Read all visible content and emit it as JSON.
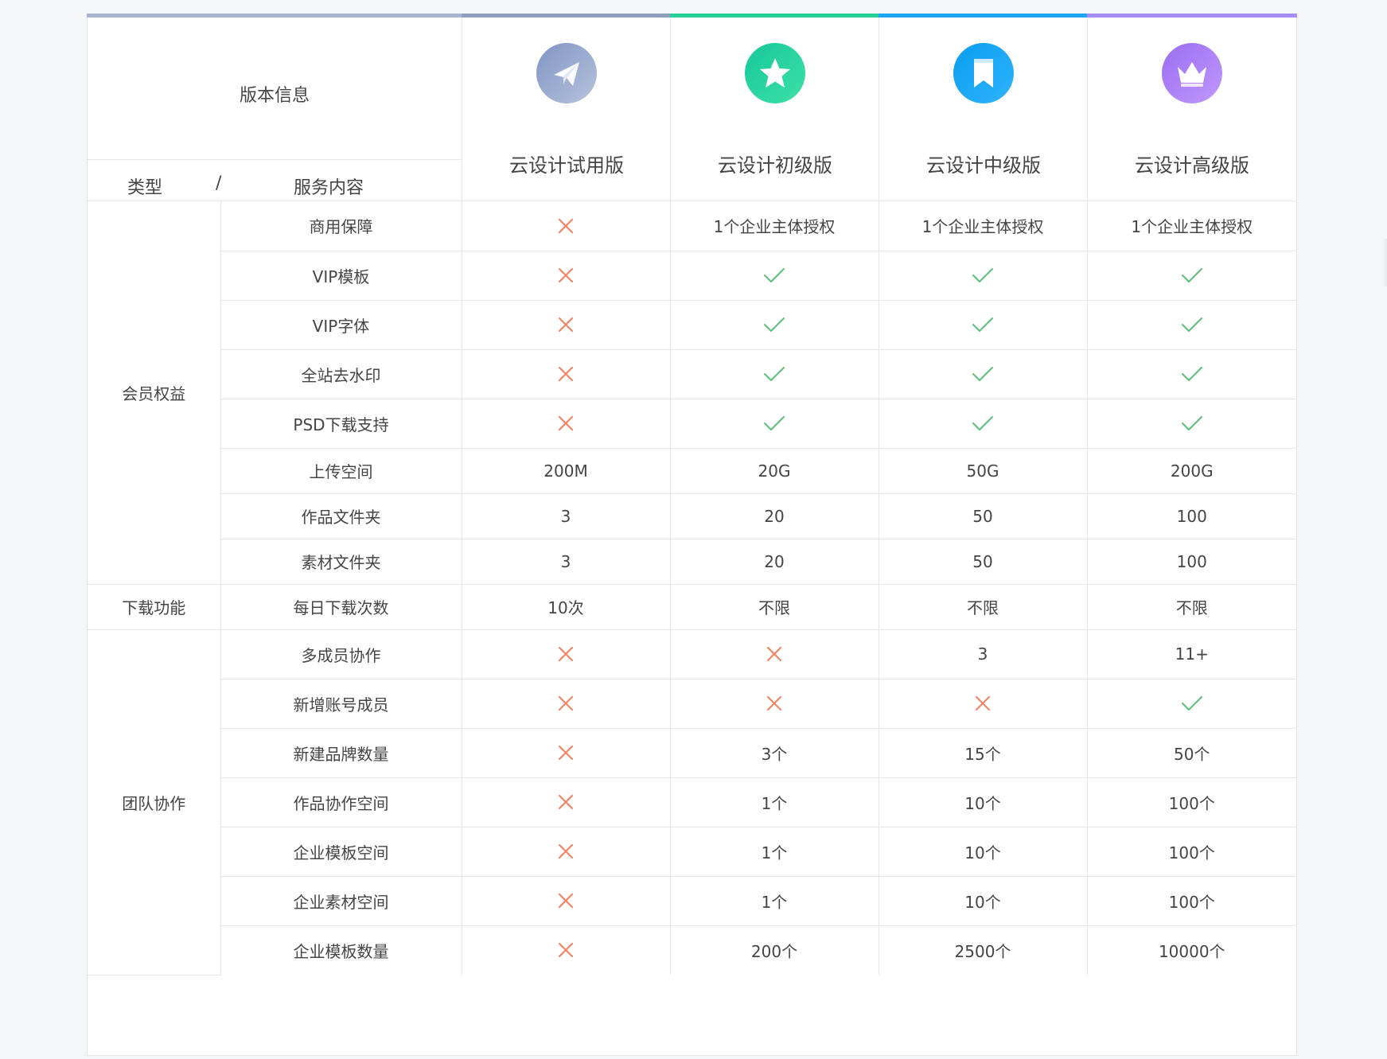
{
  "header": {
    "title": "版本信息",
    "type_label": "类型",
    "slash": "/",
    "service_label": "服务内容"
  },
  "plans": [
    {
      "name": "云设计试用版",
      "icon": "paper-plane-icon",
      "color": "#8f9fbe"
    },
    {
      "name": "云设计初级版",
      "icon": "star-icon",
      "color": "#25cf96"
    },
    {
      "name": "云设计中级版",
      "icon": "bookmark-icon",
      "color": "#1ca6f5"
    },
    {
      "name": "云设计高级版",
      "icon": "crown-icon",
      "color": "#a48df7"
    }
  ],
  "status_colors": {
    "cross": "#f4805e",
    "check": "#5cbf7c"
  },
  "categories": [
    {
      "name": "会员权益",
      "rows": [
        {
          "service": "商用保障",
          "values": [
            "cross",
            "1个企业主体授权",
            "1个企业主体授权",
            "1个企业主体授权"
          ]
        },
        {
          "service": "VIP模板",
          "values": [
            "cross",
            "check",
            "check",
            "check"
          ]
        },
        {
          "service": "VIP字体",
          "values": [
            "cross",
            "check",
            "check",
            "check"
          ]
        },
        {
          "service": "全站去水印",
          "values": [
            "cross",
            "check",
            "check",
            "check"
          ]
        },
        {
          "service": "PSD下载支持",
          "values": [
            "cross",
            "check",
            "check",
            "check"
          ]
        },
        {
          "service": "上传空间",
          "values": [
            "200M",
            "20G",
            "50G",
            "200G"
          ]
        },
        {
          "service": "作品文件夹",
          "values": [
            "3",
            "20",
            "50",
            "100"
          ]
        },
        {
          "service": "素材文件夹",
          "values": [
            "3",
            "20",
            "50",
            "100"
          ]
        }
      ]
    },
    {
      "name": "下载功能",
      "rows": [
        {
          "service": "每日下载次数",
          "values": [
            "10次",
            "不限",
            "不限",
            "不限"
          ]
        }
      ]
    },
    {
      "name": "团队协作",
      "rows": [
        {
          "service": "多成员协作",
          "values": [
            "cross",
            "cross",
            "3",
            "11+"
          ]
        },
        {
          "service": "新增账号成员",
          "values": [
            "cross",
            "cross",
            "cross",
            "check"
          ]
        },
        {
          "service": "新建品牌数量",
          "values": [
            "cross",
            "3个",
            "15个",
            "50个"
          ]
        },
        {
          "service": "作品协作空间",
          "values": [
            "cross",
            "1个",
            "10个",
            "100个"
          ]
        },
        {
          "service": "企业模板空间",
          "values": [
            "cross",
            "1个",
            "10个",
            "100个"
          ]
        },
        {
          "service": "企业素材空间",
          "values": [
            "cross",
            "1个",
            "10个",
            "100个"
          ]
        },
        {
          "service": "企业模板数量",
          "values": [
            "cross",
            "200个",
            "2500个",
            "10000个"
          ]
        }
      ]
    }
  ]
}
